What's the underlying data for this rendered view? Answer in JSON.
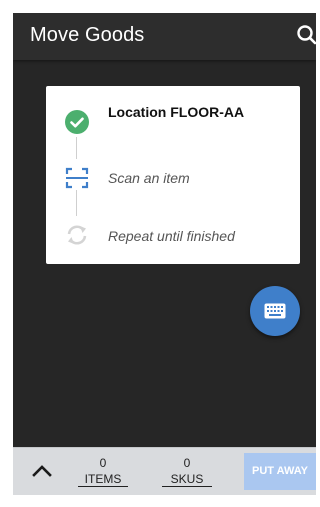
{
  "appbar": {
    "title": "Move Goods",
    "search_icon": "search-icon"
  },
  "steps": {
    "items": [
      {
        "label": "Location FLOOR-AA",
        "icon": "check-circle-icon",
        "status": "done"
      },
      {
        "label": "Scan an item",
        "icon": "scan-icon",
        "status": "active"
      },
      {
        "label": "Repeat until finished",
        "icon": "repeat-icon",
        "status": "pending"
      }
    ]
  },
  "fab": {
    "icon": "keyboard-icon"
  },
  "bottom_bar": {
    "expand_icon": "chevron-up-icon",
    "items_count": "0",
    "items_label": "ITEMS",
    "skus_count": "0",
    "skus_label": "SKUS",
    "put_away_label": "PUT AWAY"
  },
  "colors": {
    "appbar_bg": "#2d2d2d",
    "screen_bg": "#262626",
    "check_green": "#4caf6e",
    "scan_blue": "#3f7fca",
    "fab_blue": "#3f7fca",
    "bottom_bar_bg": "#d9dbde",
    "put_away_bg": "#aac7f0"
  }
}
